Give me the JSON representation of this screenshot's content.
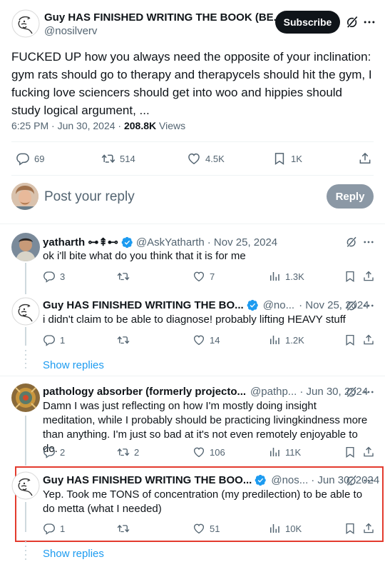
{
  "main_tweet": {
    "author_name": "Guy HAS FINISHED WRITING THE BOOK (BE...",
    "author_handle": "@nosilverv",
    "subscribe_label": "Subscribe",
    "text": "FUCKED UP how you always need the opposite of your inclination: gym rats should go to therapy and therapycels should hit the gym, I fucking love sciencers should get into woo and hippies should study logical argument, ...",
    "time": "6:25 PM · Jun 30, 2024 · ",
    "views_count": "208.8K",
    "views_label": " Views",
    "replies": "69",
    "retweets": "514",
    "likes": "4.5K",
    "bookmarks": "1K"
  },
  "composer": {
    "placeholder": "Post your reply",
    "reply_label": "Reply"
  },
  "replies": [
    {
      "author_name": "yatharth ⊶⇞⊷",
      "author_handle": "@AskYatharth",
      "date": "· Nov 25, 2024",
      "text": "ok i'll bite what do you think that it is for me",
      "replies": "3",
      "retweets": "",
      "likes": "7",
      "views": "1.3K"
    },
    {
      "author_name": "Guy HAS FINISHED WRITING THE BO...",
      "author_handle": "@no...",
      "date": "· Nov 25, 2024",
      "text": "i didn't claim to be able to diagnose! probably lifting HEAVY stuff",
      "replies": "1",
      "retweets": "",
      "likes": "14",
      "views": "1.2K"
    },
    {
      "author_name": "pathology absorber (formerly projecto...",
      "author_handle": "@pathp...",
      "date": "· Jun 30, 2024",
      "text": "Damn I was just reflecting on how I'm mostly doing insight meditation, while I probably should be practicing livingkindness more than anything. I'm just so bad at it's not even remotely enjoyable to do.",
      "replies": "2",
      "retweets": "2",
      "likes": "106",
      "views": "11K"
    },
    {
      "author_name": "Guy HAS FINISHED WRITING THE BOO...",
      "author_handle": "@nos...",
      "date": "· Jun 30, 2024",
      "text": "Yep. Took me TONS of concentration (my predilection) to be able to do metta (what I needed)",
      "replies": "1",
      "retweets": "",
      "likes": "51",
      "views": "10K"
    }
  ],
  "show_replies_label": "Show replies",
  "colors": {
    "accent": "#1d9bf0",
    "highlight": "#e0245e",
    "muted": "#536471",
    "reply_button": "#8b98a5"
  }
}
